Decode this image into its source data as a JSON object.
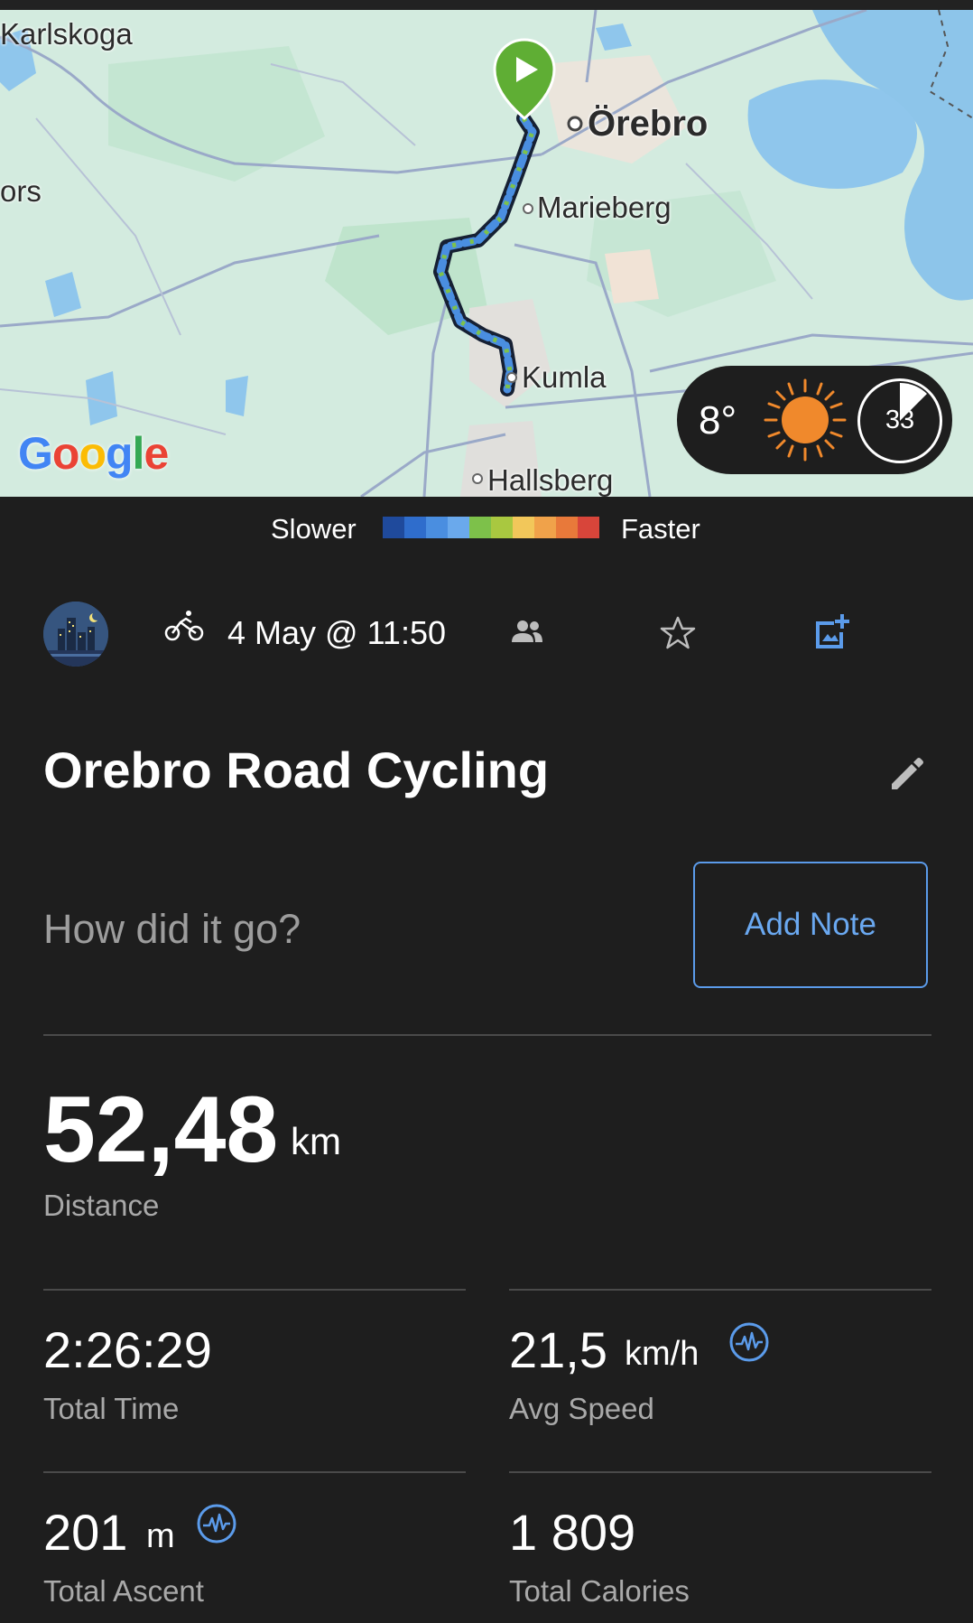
{
  "map": {
    "labels": {
      "karlskoga": "Karlskoga",
      "ors": "ors",
      "orebro": "Örebro",
      "marieberg": "Marieberg",
      "kumla": "Kumla",
      "hallsberg": "Hallsberg"
    },
    "google": [
      "G",
      "o",
      "o",
      "g",
      "l",
      "e"
    ],
    "google_colors": [
      "#4285F4",
      "#EA4335",
      "#FBBC05",
      "#4285F4",
      "#34A853",
      "#EA4335"
    ],
    "weather": {
      "temperature": "8°",
      "wind": "33"
    }
  },
  "legend": {
    "slower": "Slower",
    "faster": "Faster",
    "colors": [
      "#1f4a9c",
      "#2f6dcc",
      "#4a8ee0",
      "#6aa9ec",
      "#7dc14a",
      "#a9c840",
      "#f2c75a",
      "#f0a24a",
      "#e8793a",
      "#d8453a"
    ]
  },
  "activity": {
    "date": "4 May @ 11:50",
    "title": "Orebro Road Cycling",
    "note_prompt": "How did it go?",
    "add_note_label": "Add Note"
  },
  "stats": {
    "distance": {
      "value": "52,48",
      "unit": "km",
      "label": "Distance"
    },
    "total_time": {
      "value": "2:26:29",
      "label": "Total Time"
    },
    "avg_speed": {
      "value": "21,5",
      "unit": "km/h",
      "label": "Avg Speed"
    },
    "total_ascent": {
      "value": "201",
      "unit": "m",
      "label": "Total Ascent"
    },
    "total_calories": {
      "value": "1 809",
      "label": "Total Calories"
    }
  },
  "colors": {
    "accent": "#5b9bea",
    "route_start": "#5fae34"
  }
}
